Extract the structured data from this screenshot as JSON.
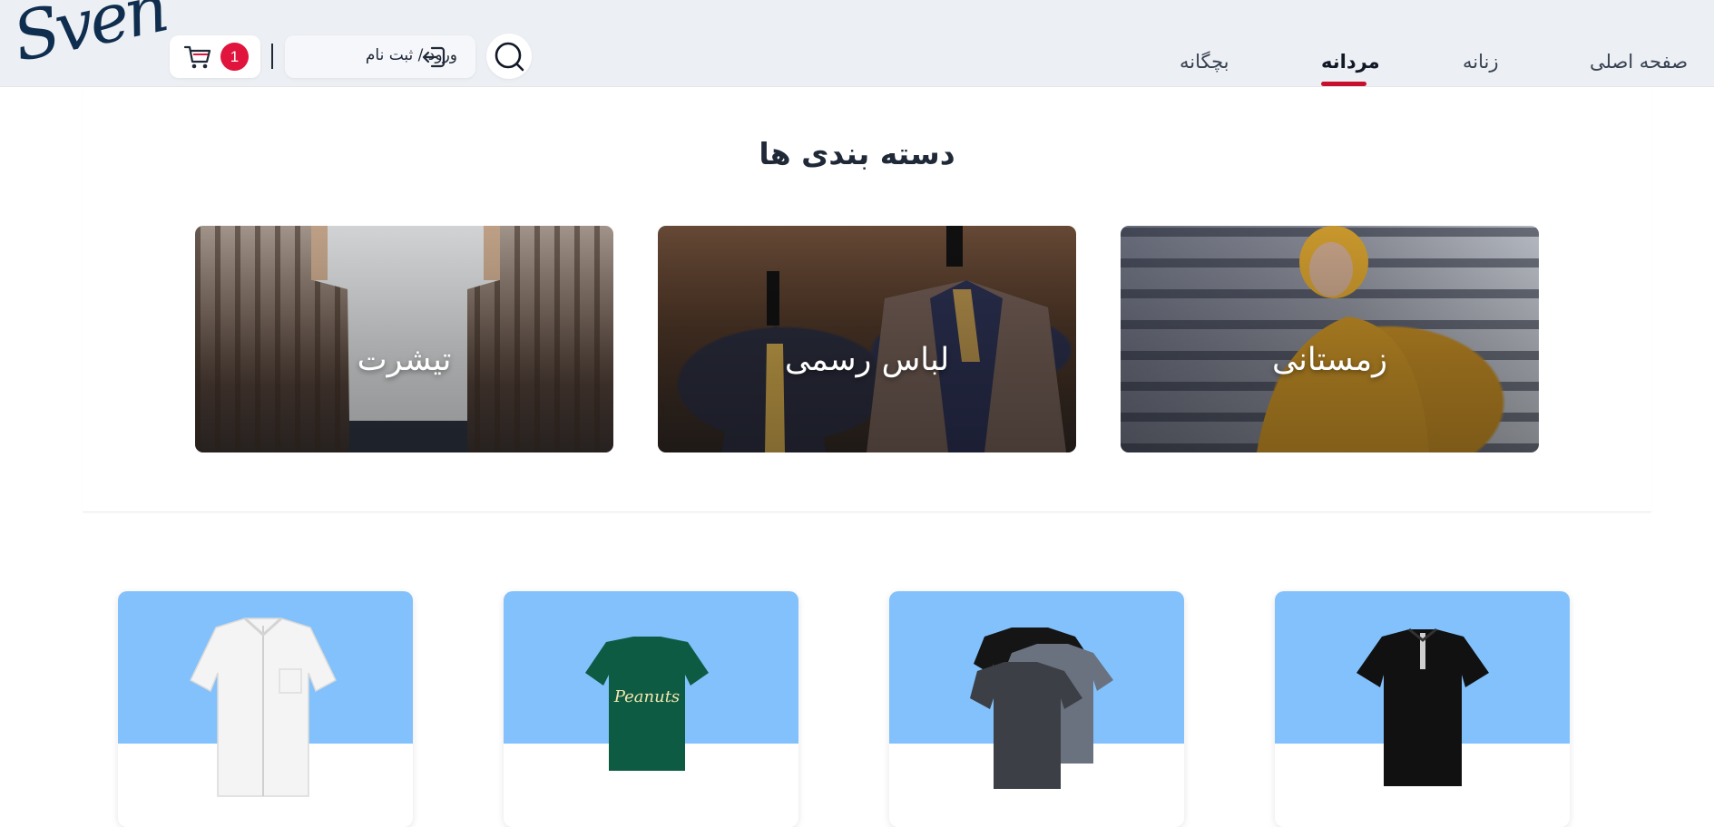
{
  "header": {
    "logo_text": "Sven",
    "cart": {
      "count": "1",
      "icon": "cart-icon",
      "badge_color": "#e0143c"
    },
    "login": {
      "label": "ورود / ثبت نام",
      "icon": "login-icon"
    },
    "search": {
      "icon": "search-icon"
    },
    "nav": [
      {
        "label": "صفحه اصلی",
        "active": false
      },
      {
        "label": "زنانه",
        "active": false
      },
      {
        "label": "مردانه",
        "active": true
      },
      {
        "label": "بچگانه",
        "active": false
      }
    ],
    "active_color": "#c8102e"
  },
  "categories": {
    "title": "دسته بندی ها",
    "items": [
      {
        "label": "زمستانی"
      },
      {
        "label": "لباس رسمی"
      },
      {
        "label": "تیشرت"
      }
    ]
  },
  "products": {
    "card_top_color": "#82c1fb",
    "items": [
      {
        "image": "black-polo-shirt"
      },
      {
        "image": "grey-tshirt-pack"
      },
      {
        "image": "green-peanuts-tshirt",
        "print_text": "Peanuts"
      },
      {
        "image": "white-button-shirt"
      }
    ]
  }
}
